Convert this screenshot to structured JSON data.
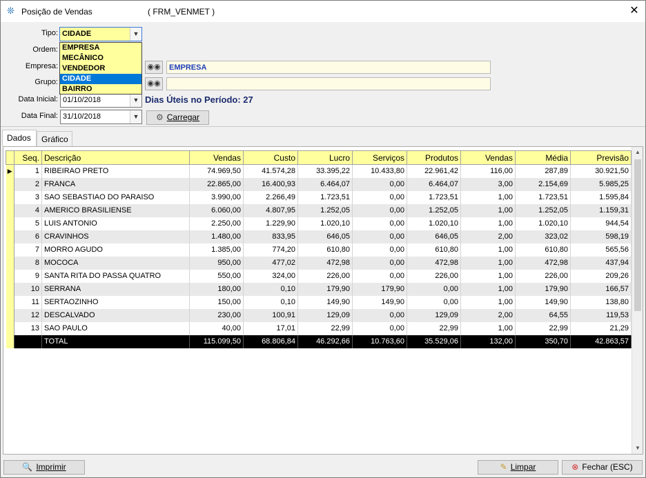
{
  "window": {
    "title": "Posição de Vendas",
    "form_id": "( FRM_VENMET )"
  },
  "filters": {
    "tipo_label": "Tipo:",
    "tipo_value": "CIDADE",
    "tipo_options": [
      "EMPRESA",
      "MECÂNICO",
      "VENDEDOR",
      "CIDADE",
      "BAIRRO"
    ],
    "ordem_label": "Ordem:",
    "empresa_label": "Empresa:",
    "empresa_value": "EMPRESA",
    "grupo_label": "Grupo:",
    "grupo_value": "",
    "data_inicial_label": "Data Inicial:",
    "data_inicial_value": "01/10/2018",
    "data_final_label": "Data Final:",
    "data_final_value": "31/10/2018",
    "dias_uteis": "Dias Úteis no Período: 27",
    "carregar_label": "Carregar"
  },
  "tabs": [
    "Dados",
    "Gráfico"
  ],
  "table": {
    "columns": [
      "Seq.",
      "Descrição",
      "Vendas",
      "Custo",
      "Lucro",
      "Serviços",
      "Produtos",
      "Vendas",
      "Média",
      "Previsão"
    ],
    "rows": [
      [
        "1",
        "RIBEIRAO PRETO",
        "74.969,50",
        "41.574,28",
        "33.395,22",
        "10.433,80",
        "22.961,42",
        "116,00",
        "287,89",
        "30.921,50"
      ],
      [
        "2",
        "FRANCA",
        "22.865,00",
        "16.400,93",
        "6.464,07",
        "0,00",
        "6.464,07",
        "3,00",
        "2.154,69",
        "5.985,25"
      ],
      [
        "3",
        "SAO SEBASTIAO DO PARAISO",
        "3.990,00",
        "2.266,49",
        "1.723,51",
        "0,00",
        "1.723,51",
        "1,00",
        "1.723,51",
        "1.595,84"
      ],
      [
        "4",
        "AMERICO BRASILIENSE",
        "6.060,00",
        "4.807,95",
        "1.252,05",
        "0,00",
        "1.252,05",
        "1,00",
        "1.252,05",
        "1.159,31"
      ],
      [
        "5",
        "LUIS ANTONIO",
        "2.250,00",
        "1.229,90",
        "1.020,10",
        "0,00",
        "1.020,10",
        "1,00",
        "1.020,10",
        "944,54"
      ],
      [
        "6",
        "CRAVINHOS",
        "1.480,00",
        "833,95",
        "646,05",
        "0,00",
        "646,05",
        "2,00",
        "323,02",
        "598,19"
      ],
      [
        "7",
        "MORRO AGUDO",
        "1.385,00",
        "774,20",
        "610,80",
        "0,00",
        "610,80",
        "1,00",
        "610,80",
        "565,56"
      ],
      [
        "8",
        "MOCOCA",
        "950,00",
        "477,02",
        "472,98",
        "0,00",
        "472,98",
        "1,00",
        "472,98",
        "437,94"
      ],
      [
        "9",
        "SANTA RITA DO PASSA QUATRO",
        "550,00",
        "324,00",
        "226,00",
        "0,00",
        "226,00",
        "1,00",
        "226,00",
        "209,26"
      ],
      [
        "10",
        "SERRANA",
        "180,00",
        "0,10",
        "179,90",
        "179,90",
        "0,00",
        "1,00",
        "179,90",
        "166,57"
      ],
      [
        "11",
        "SERTAOZINHO",
        "150,00",
        "0,10",
        "149,90",
        "149,90",
        "0,00",
        "1,00",
        "149,90",
        "138,80"
      ],
      [
        "12",
        "DESCALVADO",
        "230,00",
        "100,91",
        "129,09",
        "0,00",
        "129,09",
        "2,00",
        "64,55",
        "119,53"
      ],
      [
        "13",
        "SAO PAULO",
        "40,00",
        "17,01",
        "22,99",
        "0,00",
        "22,99",
        "1,00",
        "22,99",
        "21,29"
      ]
    ],
    "total": [
      "",
      "TOTAL",
      "115.099,50",
      "68.806,84",
      "46.292,66",
      "10.763,60",
      "35.529,06",
      "132,00",
      "350,70",
      "42.863,57"
    ]
  },
  "footer": {
    "imprimir_label": "Imprimir",
    "limpar_label": "Limpar",
    "fechar_label": "Fechar (ESC)"
  },
  "colors": {
    "header_yellow": "#ffff9e",
    "selection_blue": "#0078d7",
    "total_row": "#000000"
  }
}
